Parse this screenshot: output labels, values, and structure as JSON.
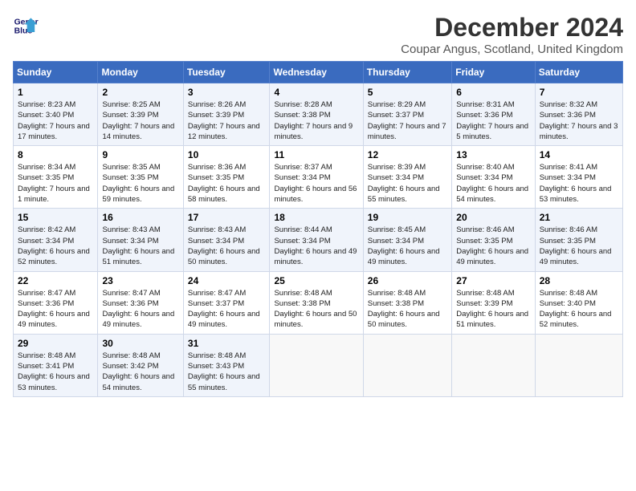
{
  "header": {
    "logo_line1": "General",
    "logo_line2": "Blue",
    "title": "December 2024",
    "subtitle": "Coupar Angus, Scotland, United Kingdom"
  },
  "days_of_week": [
    "Sunday",
    "Monday",
    "Tuesday",
    "Wednesday",
    "Thursday",
    "Friday",
    "Saturday"
  ],
  "weeks": [
    [
      {
        "day": "1",
        "sunrise": "Sunrise: 8:23 AM",
        "sunset": "Sunset: 3:40 PM",
        "daylight": "Daylight: 7 hours and 17 minutes."
      },
      {
        "day": "2",
        "sunrise": "Sunrise: 8:25 AM",
        "sunset": "Sunset: 3:39 PM",
        "daylight": "Daylight: 7 hours and 14 minutes."
      },
      {
        "day": "3",
        "sunrise": "Sunrise: 8:26 AM",
        "sunset": "Sunset: 3:39 PM",
        "daylight": "Daylight: 7 hours and 12 minutes."
      },
      {
        "day": "4",
        "sunrise": "Sunrise: 8:28 AM",
        "sunset": "Sunset: 3:38 PM",
        "daylight": "Daylight: 7 hours and 9 minutes."
      },
      {
        "day": "5",
        "sunrise": "Sunrise: 8:29 AM",
        "sunset": "Sunset: 3:37 PM",
        "daylight": "Daylight: 7 hours and 7 minutes."
      },
      {
        "day": "6",
        "sunrise": "Sunrise: 8:31 AM",
        "sunset": "Sunset: 3:36 PM",
        "daylight": "Daylight: 7 hours and 5 minutes."
      },
      {
        "day": "7",
        "sunrise": "Sunrise: 8:32 AM",
        "sunset": "Sunset: 3:36 PM",
        "daylight": "Daylight: 7 hours and 3 minutes."
      }
    ],
    [
      {
        "day": "8",
        "sunrise": "Sunrise: 8:34 AM",
        "sunset": "Sunset: 3:35 PM",
        "daylight": "Daylight: 7 hours and 1 minute."
      },
      {
        "day": "9",
        "sunrise": "Sunrise: 8:35 AM",
        "sunset": "Sunset: 3:35 PM",
        "daylight": "Daylight: 6 hours and 59 minutes."
      },
      {
        "day": "10",
        "sunrise": "Sunrise: 8:36 AM",
        "sunset": "Sunset: 3:35 PM",
        "daylight": "Daylight: 6 hours and 58 minutes."
      },
      {
        "day": "11",
        "sunrise": "Sunrise: 8:37 AM",
        "sunset": "Sunset: 3:34 PM",
        "daylight": "Daylight: 6 hours and 56 minutes."
      },
      {
        "day": "12",
        "sunrise": "Sunrise: 8:39 AM",
        "sunset": "Sunset: 3:34 PM",
        "daylight": "Daylight: 6 hours and 55 minutes."
      },
      {
        "day": "13",
        "sunrise": "Sunrise: 8:40 AM",
        "sunset": "Sunset: 3:34 PM",
        "daylight": "Daylight: 6 hours and 54 minutes."
      },
      {
        "day": "14",
        "sunrise": "Sunrise: 8:41 AM",
        "sunset": "Sunset: 3:34 PM",
        "daylight": "Daylight: 6 hours and 53 minutes."
      }
    ],
    [
      {
        "day": "15",
        "sunrise": "Sunrise: 8:42 AM",
        "sunset": "Sunset: 3:34 PM",
        "daylight": "Daylight: 6 hours and 52 minutes."
      },
      {
        "day": "16",
        "sunrise": "Sunrise: 8:43 AM",
        "sunset": "Sunset: 3:34 PM",
        "daylight": "Daylight: 6 hours and 51 minutes."
      },
      {
        "day": "17",
        "sunrise": "Sunrise: 8:43 AM",
        "sunset": "Sunset: 3:34 PM",
        "daylight": "Daylight: 6 hours and 50 minutes."
      },
      {
        "day": "18",
        "sunrise": "Sunrise: 8:44 AM",
        "sunset": "Sunset: 3:34 PM",
        "daylight": "Daylight: 6 hours and 49 minutes."
      },
      {
        "day": "19",
        "sunrise": "Sunrise: 8:45 AM",
        "sunset": "Sunset: 3:34 PM",
        "daylight": "Daylight: 6 hours and 49 minutes."
      },
      {
        "day": "20",
        "sunrise": "Sunrise: 8:46 AM",
        "sunset": "Sunset: 3:35 PM",
        "daylight": "Daylight: 6 hours and 49 minutes."
      },
      {
        "day": "21",
        "sunrise": "Sunrise: 8:46 AM",
        "sunset": "Sunset: 3:35 PM",
        "daylight": "Daylight: 6 hours and 49 minutes."
      }
    ],
    [
      {
        "day": "22",
        "sunrise": "Sunrise: 8:47 AM",
        "sunset": "Sunset: 3:36 PM",
        "daylight": "Daylight: 6 hours and 49 minutes."
      },
      {
        "day": "23",
        "sunrise": "Sunrise: 8:47 AM",
        "sunset": "Sunset: 3:36 PM",
        "daylight": "Daylight: 6 hours and 49 minutes."
      },
      {
        "day": "24",
        "sunrise": "Sunrise: 8:47 AM",
        "sunset": "Sunset: 3:37 PM",
        "daylight": "Daylight: 6 hours and 49 minutes."
      },
      {
        "day": "25",
        "sunrise": "Sunrise: 8:48 AM",
        "sunset": "Sunset: 3:38 PM",
        "daylight": "Daylight: 6 hours and 50 minutes."
      },
      {
        "day": "26",
        "sunrise": "Sunrise: 8:48 AM",
        "sunset": "Sunset: 3:38 PM",
        "daylight": "Daylight: 6 hours and 50 minutes."
      },
      {
        "day": "27",
        "sunrise": "Sunrise: 8:48 AM",
        "sunset": "Sunset: 3:39 PM",
        "daylight": "Daylight: 6 hours and 51 minutes."
      },
      {
        "day": "28",
        "sunrise": "Sunrise: 8:48 AM",
        "sunset": "Sunset: 3:40 PM",
        "daylight": "Daylight: 6 hours and 52 minutes."
      }
    ],
    [
      {
        "day": "29",
        "sunrise": "Sunrise: 8:48 AM",
        "sunset": "Sunset: 3:41 PM",
        "daylight": "Daylight: 6 hours and 53 minutes."
      },
      {
        "day": "30",
        "sunrise": "Sunrise: 8:48 AM",
        "sunset": "Sunset: 3:42 PM",
        "daylight": "Daylight: 6 hours and 54 minutes."
      },
      {
        "day": "31",
        "sunrise": "Sunrise: 8:48 AM",
        "sunset": "Sunset: 3:43 PM",
        "daylight": "Daylight: 6 hours and 55 minutes."
      },
      null,
      null,
      null,
      null
    ]
  ]
}
